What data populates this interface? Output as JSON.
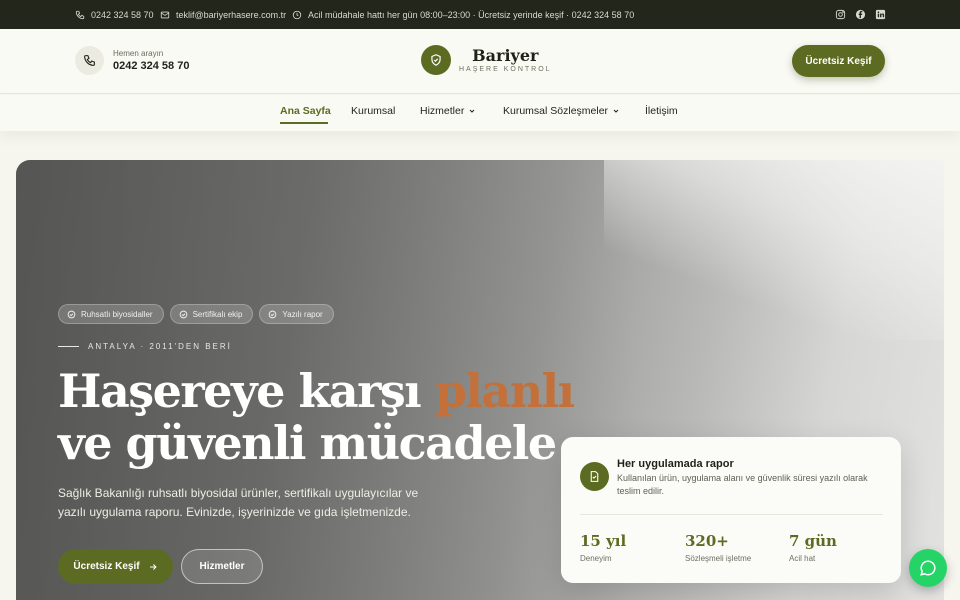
{
  "topbar": {
    "phone": "0242 324 58 70",
    "email": "teklif@bariyerhasere.com.tr",
    "hours": "Acil müdahale hattı her gün 08:00–23:00 · Ücretsiz yerinde keşif · 0242 324 58 70",
    "social": [
      "instagram-icon",
      "facebook-icon",
      "linkedin-icon"
    ]
  },
  "header": {
    "phone_label": "Hemen arayın",
    "phone_number": "0242 324 58 70",
    "brand_name": "Bariyer",
    "brand_sub": "HAŞERE KONTROL",
    "cta": "Ücretsiz Keşif"
  },
  "nav": {
    "items": [
      {
        "label": "Ana Sayfa",
        "active": true
      },
      {
        "label": "Kurumsal"
      },
      {
        "label": "Hizmetler"
      },
      {
        "label": "Kurumsal Sözleşmeler"
      },
      {
        "label": "İletişim"
      }
    ]
  },
  "hero": {
    "chips": [
      "Ruhsatlı biyosidaller",
      "Sertifikalı ekip",
      "Yazılı rapor"
    ],
    "eyebrow": "ANTALYA · 2011'DEN BERİ",
    "headline_part1": "Haşereye karşı ",
    "headline_accent": "planlı",
    "headline_line2": "ve güvenli mücadele",
    "lead": "Sağlık Bakanlığı ruhsatlı biyosidal ürünler, sertifikalı uygulayıcılar ve yazılı uygulama raporu. Evinizde, işyerinizde ve gıda işletmenizde.",
    "primary_cta": "Ücretsiz Keşif",
    "secondary_cta": "Hizmetler"
  },
  "card": {
    "title": "Her uygulamada rapor",
    "text": "Kullanılan ürün, uygulama alanı ve güvenlik süresi yazılı olarak teslim edilir.",
    "stats": [
      {
        "value": "15 yıl",
        "label": "Deneyim"
      },
      {
        "value": "320+",
        "label": "Sözleşmeli işletme"
      },
      {
        "value": "7 gün",
        "label": "Acil hat"
      }
    ]
  },
  "colors": {
    "brand": "#5c6b22",
    "accent": "#c4703a",
    "topbar": "#22261b",
    "chat": "#25d366"
  }
}
